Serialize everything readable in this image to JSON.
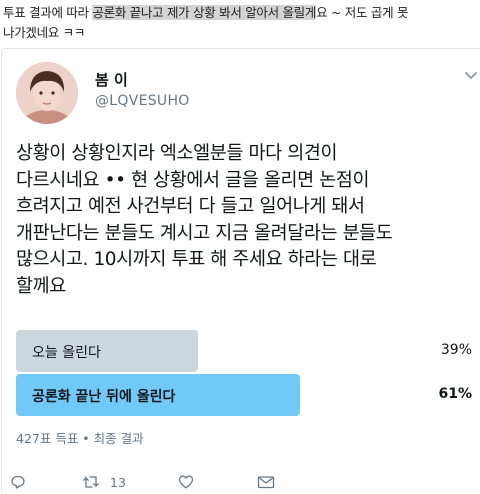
{
  "header_text": {
    "part1": "투표 결과에 따라 ",
    "highlight1": "공론화 끝나고 제가 상황 봐서 알아서 올릴게",
    "part2": "요 ~ 저도 곱게 못",
    "line2": "나가겠네요 ㅋㅋ"
  },
  "tweet": {
    "name": "봄 이",
    "handle": "@LQVESUHO",
    "text": "상황이 상황인지라 엑소엘분들 마다 의견이\n다르시네요 •• 현 상황에서 글을 올리면 논점이\n흐려지고 예전 사건부터 다 들고 일어나게 돼서\n개판난다는 분들도 계시고 지금 올려달라는 분들도\n많으시고. 10시까지 투표 해 주세요 하라는 대로\n할께요"
  },
  "poll": {
    "options": [
      {
        "label": "오늘 올린다",
        "percent_text": "39%",
        "percent": 39,
        "color": "#ccd6dd",
        "winner": false
      },
      {
        "label": "공론화 끝난 뒤에 올린다",
        "percent_text": "61%",
        "percent": 61,
        "color": "#71c9f8",
        "winner": true
      }
    ],
    "meta": "427표 득표 • 최종 결과"
  },
  "actions": {
    "reply_icon": "reply-icon",
    "retweet_icon": "retweet-icon",
    "retweet_count": "13",
    "like_icon": "heart-icon",
    "dm_icon": "mail-icon"
  }
}
